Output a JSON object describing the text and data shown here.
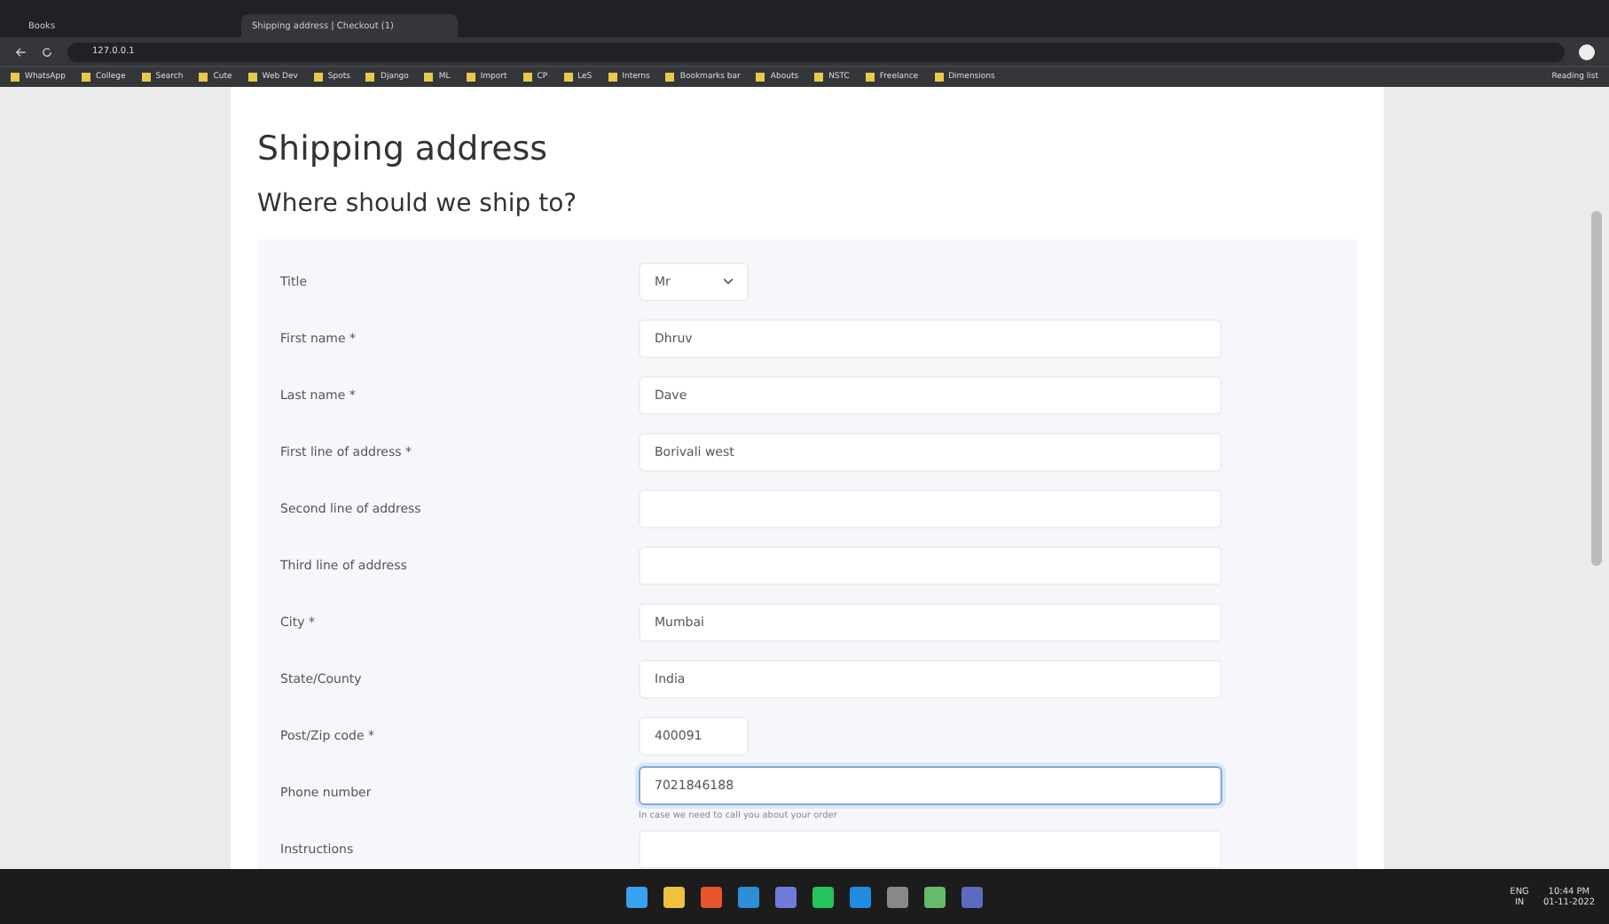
{
  "browser": {
    "tabs": [
      {
        "label": "Books",
        "selected": false
      },
      {
        "label": "Shipping address | Checkout (1)",
        "selected": true
      }
    ],
    "url": "127.0.0.1",
    "bookmarks": [
      "WhatsApp",
      "College",
      "Search",
      "Cute",
      "Web Dev",
      "Spots",
      "Django",
      "ML",
      "Import",
      "CP",
      "LeS",
      "Interns",
      "Bookmarks bar",
      "Abouts",
      "NSTC",
      "Freelance",
      "Dimensions"
    ],
    "reading_list": "Reading list"
  },
  "page": {
    "title": "Shipping address",
    "subtitle": "Where should we ship to?"
  },
  "form": {
    "fields": [
      {
        "kind": "select",
        "label": "Title",
        "value": "Mr"
      },
      {
        "kind": "text",
        "label": "First name *",
        "value": "Dhruv"
      },
      {
        "kind": "text",
        "label": "Last name *",
        "value": "Dave"
      },
      {
        "kind": "text",
        "label": "First line of address *",
        "value": "Borivali west"
      },
      {
        "kind": "text",
        "label": "Second line of address"
      },
      {
        "kind": "text",
        "label": "Third line of address"
      },
      {
        "kind": "text",
        "label": "City *",
        "value": "Mumbai"
      },
      {
        "kind": "text",
        "label": "State/County",
        "value": "India"
      },
      {
        "kind": "short",
        "label": "Post/Zip code *",
        "value": "400091"
      },
      {
        "kind": "text",
        "label": "Phone number",
        "value": "7021846188",
        "focused": true,
        "hint": "In case we need to call you about your order"
      },
      {
        "kind": "text",
        "label": "Instructions"
      }
    ]
  },
  "taskbar": {
    "language": "ENG",
    "region": "IN",
    "time": "10:44 PM",
    "date": "01-11-2022"
  }
}
